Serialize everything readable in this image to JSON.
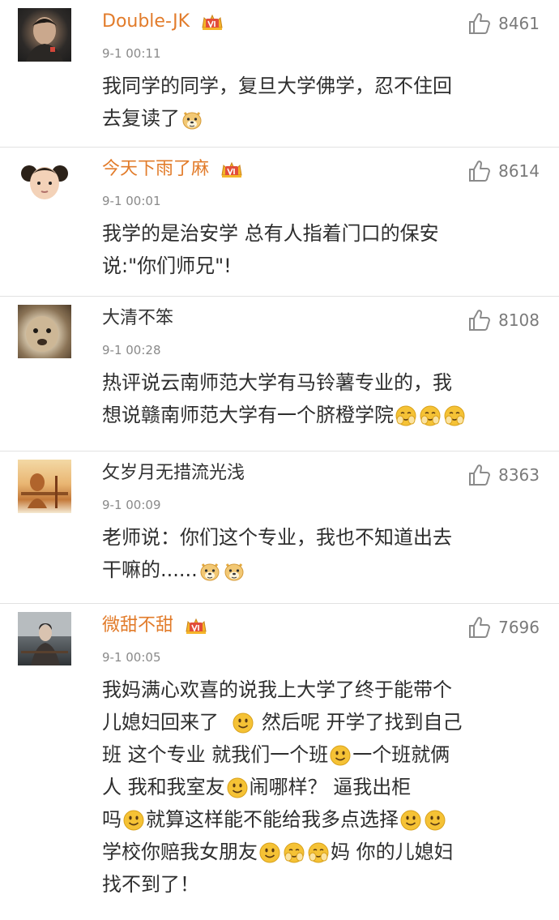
{
  "comments": [
    {
      "username": "Double-JK",
      "timestamp": "9-1 00:11",
      "likes": "8461",
      "text": [
        "我同学的同学，复旦大学佛学，忍不住回",
        "去复读了"
      ]
    },
    {
      "username": "今天下雨了麻",
      "timestamp": "9-1 00:01",
      "likes": "8614",
      "text": [
        "我学的是治安学 总有人指着门口的保安",
        "说:\"你们师兄\"!"
      ]
    },
    {
      "username": "大清不笨",
      "timestamp": "9-1 00:28",
      "likes": "8108",
      "text": [
        "热评说云南师范大学有马铃薯专业的，我",
        "想说赣南师范大学有一个脐橙学院"
      ]
    },
    {
      "username": "攵岁月无措流光浅",
      "timestamp": "9-1 00:09",
      "likes": "8363",
      "text": [
        "老师说：你们这个专业，我也不知道出去",
        "干嘛的......"
      ]
    },
    {
      "username": "微甜不甜",
      "timestamp": "9-1 00:05",
      "likes": "7696",
      "text": [
        "我妈满心欢喜的说我上大学了终于能带个",
        "儿媳妇回来了",
        "然后呢 开学了找到自己",
        "班 这个专业 就我们一个班",
        "一个班就俩",
        "人 我和我室友",
        "闹哪样？ 逼我出柜",
        "吗",
        "就算这样能不能给我多点选择",
        "学校你赔我女朋友",
        "妈 你的儿媳妇",
        "找不到了！"
      ]
    }
  ],
  "icons": {
    "thumb": "thumb-up-icon",
    "crown": "vip-crown-icon",
    "emoji_doge": "doge-emoji-icon",
    "emoji_smile": "smile-emoji-icon",
    "emoji_cover": "cover-face-emoji-icon"
  },
  "colors": {
    "vip_name": "#e27c2b",
    "timestamp": "#8a8a8a",
    "divider": "#e2e2e2",
    "emoji": "#f5c235"
  }
}
